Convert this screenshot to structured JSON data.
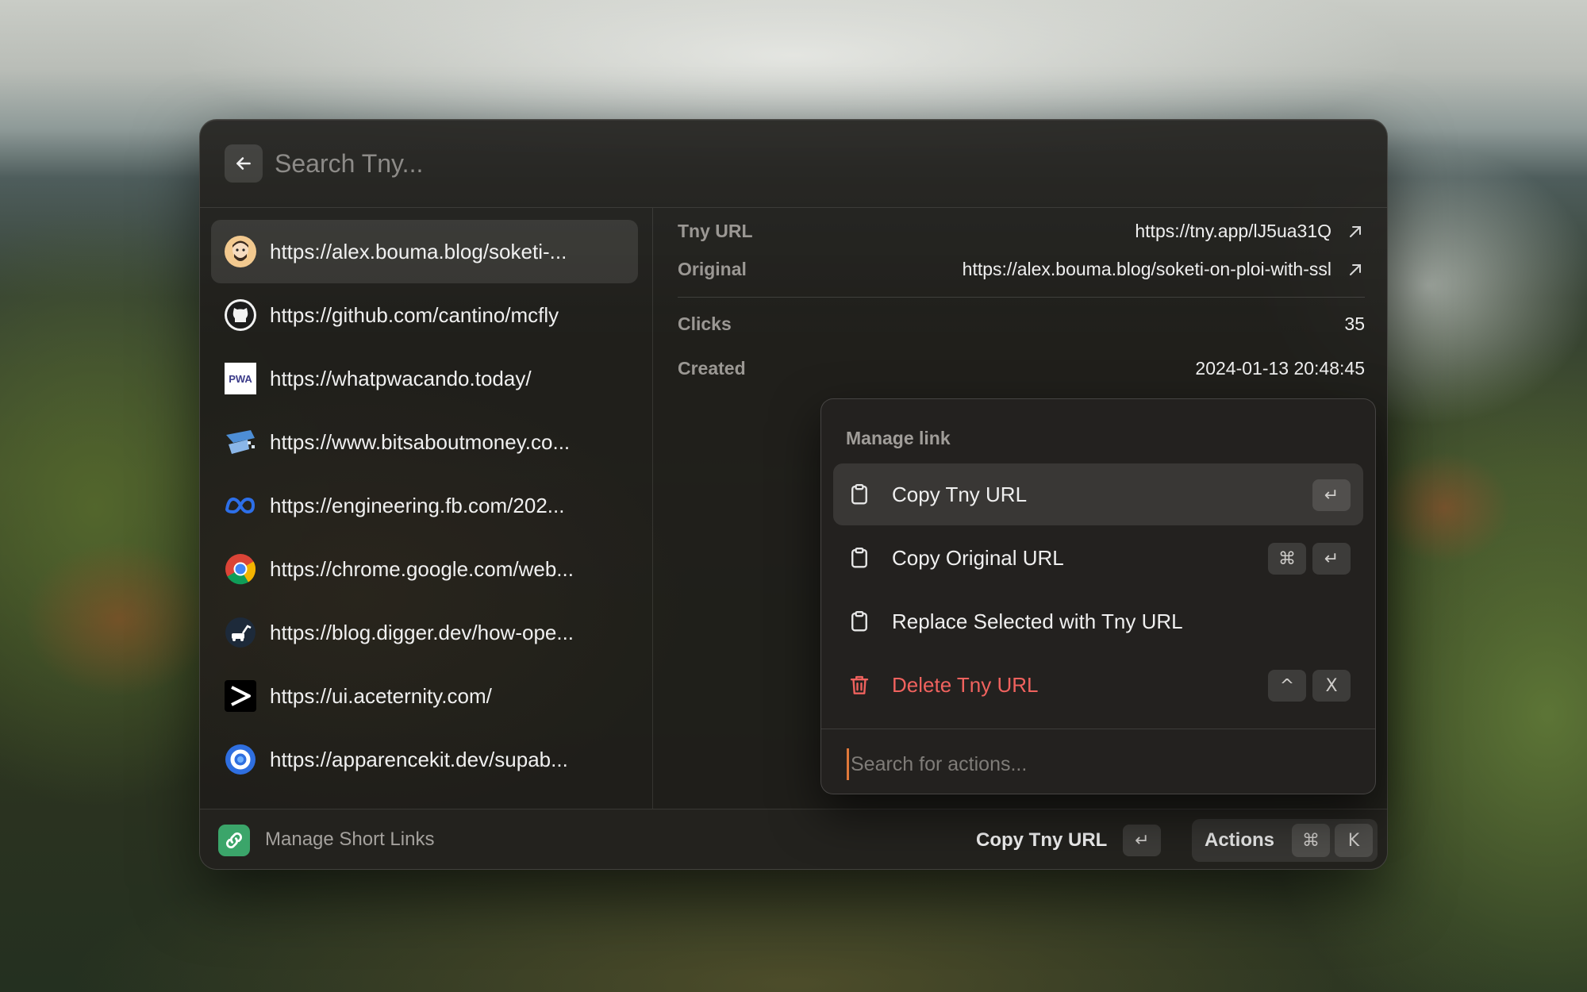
{
  "search": {
    "placeholder": "Search Tny..."
  },
  "links": [
    {
      "label": "https://alex.bouma.blog/soketi-...",
      "icon": "avatar-favicon-icon"
    },
    {
      "label": "https://github.com/cantino/mcfly",
      "icon": "github-icon"
    },
    {
      "label": "https://whatpwacando.today/",
      "icon": "pwa-icon"
    },
    {
      "label": "https://www.bitsaboutmoney.co...",
      "icon": "bitsaboutmoney-icon"
    },
    {
      "label": "https://engineering.fb.com/202...",
      "icon": "meta-icon"
    },
    {
      "label": "https://chrome.google.com/web...",
      "icon": "chrome-icon"
    },
    {
      "label": "https://blog.digger.dev/how-ope...",
      "icon": "digger-icon"
    },
    {
      "label": "https://ui.aceternity.com/",
      "icon": "aceternity-icon"
    },
    {
      "label": "https://apparencekit.dev/supab...",
      "icon": "apparencekit-icon"
    }
  ],
  "details": {
    "tny_url_label": "Tny URL",
    "tny_url_value": "https://tny.app/lJ5ua31Q",
    "original_label": "Original",
    "original_value": "https://alex.bouma.blog/soketi-on-ploi-with-ssl",
    "clicks_label": "Clicks",
    "clicks_value": "35",
    "created_label": "Created",
    "created_value": "2024-01-13 20:48:45"
  },
  "menu": {
    "section_title": "Manage link",
    "items": [
      {
        "label": "Copy Tny URL",
        "icon": "clipboard-icon",
        "shortcut": [
          "↵"
        ]
      },
      {
        "label": "Copy Original URL",
        "icon": "clipboard-icon",
        "shortcut": [
          "⌘",
          "↵"
        ]
      },
      {
        "label": "Replace Selected with Tny URL",
        "icon": "clipboard-icon",
        "shortcut": []
      },
      {
        "label": "Delete Tny URL",
        "icon": "trash-icon",
        "shortcut": [
          "^",
          "X"
        ]
      }
    ],
    "search_placeholder": "Search for actions..."
  },
  "footer": {
    "title": "Manage Short Links",
    "primary_action": "Copy Tny URL",
    "primary_key": "↵",
    "actions_label": "Actions",
    "actions_keys": [
      "⌘",
      "K"
    ]
  },
  "colors": {
    "danger": "#f0625e",
    "app_accent": "#3ba56a",
    "cursor": "#e0783a"
  }
}
